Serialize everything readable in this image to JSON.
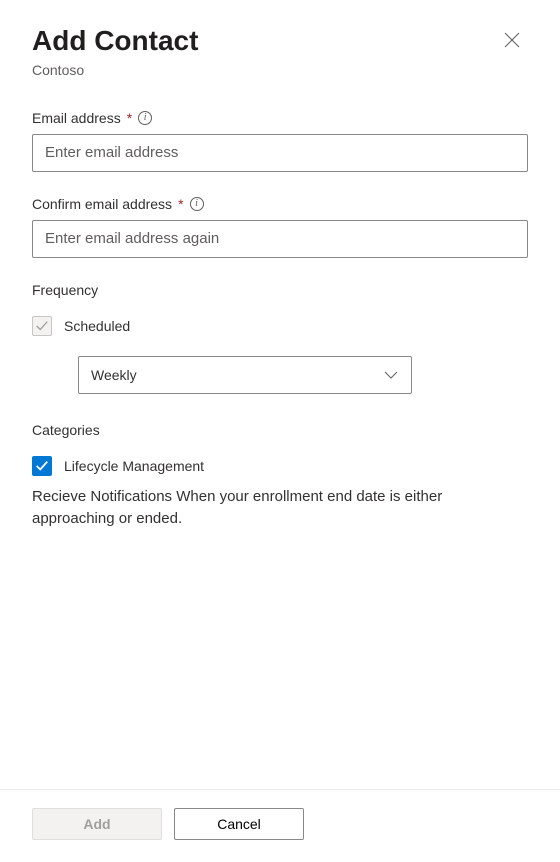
{
  "header": {
    "title": "Add Contact",
    "subtitle": "Contoso"
  },
  "fields": {
    "email": {
      "label": "Email address",
      "placeholder": "Enter email address",
      "value": ""
    },
    "confirm": {
      "label": "Confirm email address",
      "placeholder": "Enter email address again",
      "value": ""
    }
  },
  "frequency": {
    "label": "Frequency",
    "scheduled_label": "Scheduled",
    "select_value": "Weekly"
  },
  "categories": {
    "label": "Categories",
    "lifecycle_label": "Lifecycle Management",
    "lifecycle_desc": "Recieve Notifications When your enrollment end date is either approaching or ended."
  },
  "footer": {
    "add": "Add",
    "cancel": "Cancel"
  }
}
